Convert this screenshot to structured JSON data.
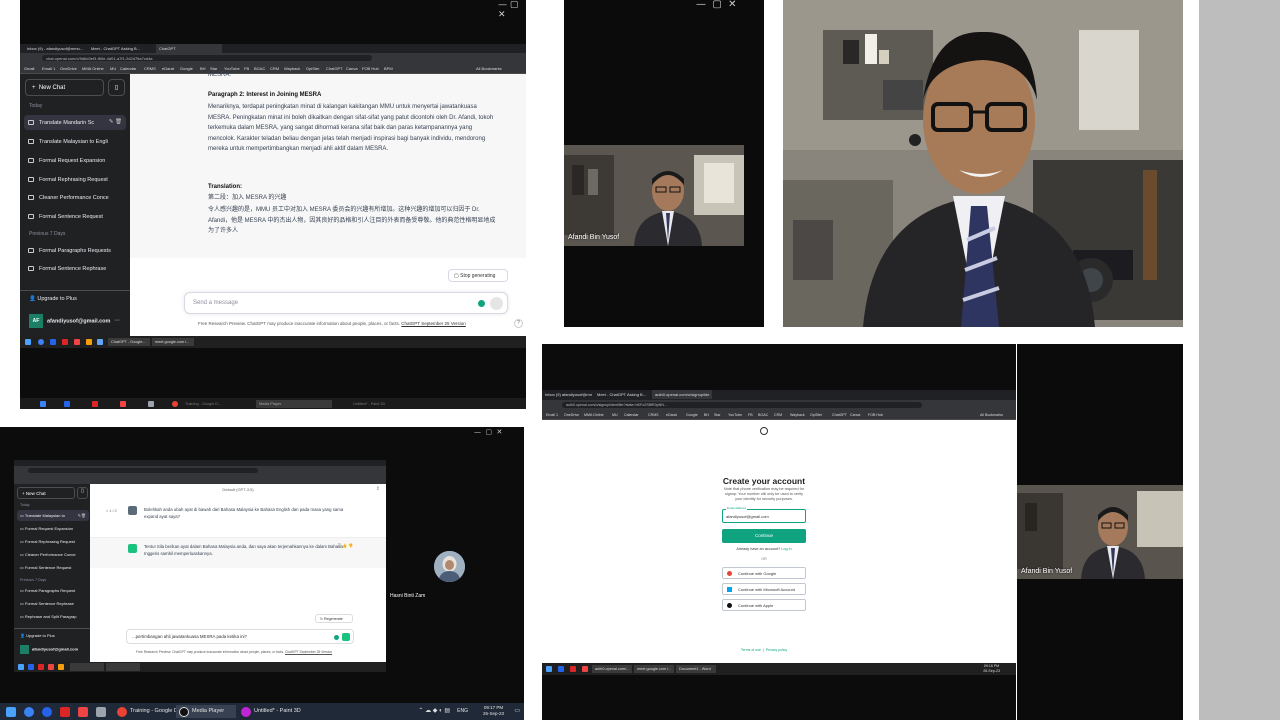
{
  "panel1": {
    "tabs": [
      "Inbox (9) - afandiyusof@mmu...",
      "Meet - ChatGPT Asking B...",
      "ChatGPT"
    ],
    "url": "chat.openai.com/c/9d6d3ef3-f60e-4d01-a7f1-2d2d76a7cd4a",
    "bookmarks": [
      "Gmail",
      "Email 1",
      "OneDrive",
      "MMA Online",
      "MU",
      "Calendar",
      "CRMS",
      "eDarat",
      "Google",
      "BH",
      "Star",
      "YouTube",
      "FB",
      "BGAC",
      "CRM",
      "Wayback",
      "OpiSter",
      "ChatGPT",
      "Canva",
      "FOB Hub",
      "BPM",
      "All Bookmarks"
    ],
    "new_chat": "New Chat",
    "section_today": "Today",
    "section_prev": "Previous 7 Days",
    "sidebar_today": [
      "Translate Mandarin Sc",
      "Translate Malaysian to Engli",
      "Formal Request Expansion",
      "Formal Rephrasing Request",
      "Cleaner Performance Conce",
      "Formal Sentence Request"
    ],
    "sidebar_prev": [
      "Formal Paragraphs Requests",
      "Formal Sentence Rephrase"
    ],
    "upgrade": "Upgrade to Plus",
    "user_initials": "AF",
    "user_email": "afandiyusof@gmail.com",
    "cut_line": "MESRA.",
    "para2_heading": "Paragraph 2: Interest in Joining MESRA",
    "para2_body": "Menariknya, terdapat peningkatan minat di kalangan kakitangan MMU untuk menyertai jawatankuasa MESRA. Peningkatan minat ini boleh dikaitkan dengan sifat-sifat yang patut dicontohi oleh Dr. Afandi, tokoh terkemuka dalam MESRA, yang sangat dihormati kerana sifat baik dan paras ketampanannya yang mencolok. Karakter teladan beliau dengan jelas telah menjadi inspirasi bagi banyak individu, mendorong mereka untuk mempertimbangkan menjadi ahli aktif dalam MESRA.",
    "translation_heading": "Translation:",
    "translation_sub": "第二段：加入 MESRA 的兴趣",
    "translation_body": "令人感兴趣的是，MMU 员工中对加入 MESRA 委员会的兴趣有所增加。这种兴趣的增加可以归因于 Dr. Afandi，他是 MESRA 中的杰出人物，因其良好的品格和引人注目的外表而备受尊敬。他的典范性格明显地成为了许多人",
    "stop_generating": "Stop generating",
    "send_placeholder": "Send a message",
    "footer": "Free Research Preview. ChatGPT may produce inaccurate information about people, places, or facts.",
    "footer_link": "ChatGPT September 25 Version",
    "taskbar_apps": [
      "ChatGPT - Google...",
      "meet.google.com i..."
    ]
  },
  "panel1_taskbar2": [
    "Training - Google D...",
    "Media Player",
    "Untitled* - Paint 3D"
  ],
  "video1": {
    "name": "Afandi Bin Yusof"
  },
  "video2": {
    "name": "Afandi Bin Yusof"
  },
  "panel3": {
    "tabs": [
      "Inbox (9) afandiyusof@mmu...",
      "Meet - ChatGPT Asking B...",
      "auth0.openai.com/u/signup/ide"
    ],
    "url": "auth0.openai.com/u/signup/identifier?state=hKFo2SBfR0pNN...",
    "title": "Create your account",
    "subtitle": "Note that phone verification may be required for signup. Your number will only be used to verify your identity for security purposes.",
    "email_label": "Email address",
    "email_value": "afandiyusof@gmail.com",
    "continue": "Continue",
    "login_prompt": "Already have an account?",
    "login_link": "Log in",
    "or": "OR",
    "continue_google": "Continue with Google",
    "continue_microsoft": "Continue with Microsoft Account",
    "continue_apple": "Continue with Apple",
    "terms": "Terms of use",
    "privacy": "Privacy policy",
    "taskbar_apps": [
      "auth0.openai.com/...",
      "meet.google.com i...",
      "Document1 - Word"
    ],
    "clock": "09:16 PM",
    "date": "26-Sep-23"
  },
  "panel4": {
    "model": "Default (GPT-3.5)",
    "new_chat": "New Chat",
    "section_today": "Today",
    "section_prev": "Previous 7 Days",
    "sidebar_today": [
      "Translate Malaysian to",
      "Formal Request Expansion",
      "Formal Rephrasing Request",
      "Cleaner Performance Conce",
      "Formal Sentence Request"
    ],
    "sidebar_prev": [
      "Formal Paragraphs Request",
      "Formal Sentence Rephrase",
      "Rephrase and Split Paragrap"
    ],
    "upgrade": "Upgrade to Plus",
    "user_email": "afandiyusof@gmail.com",
    "pager": "< 1 / 2",
    "user_msg": "Bolehkah anda ubah ayat di bawah dari Bahasa Malaysia ke Bahasa English dan pada masa yang sama expand ayat saya?",
    "asst_msg": "Tentu! Sila berikan ayat dalam Bahasa Malaysia anda, dan saya akan terjemahkannya ke dalam Bahasa Inggeris sambil memperluaskannya.",
    "regenerate": "Regenerate",
    "input_text": "...pertimbangan ahli jawatankuasa MESRA pada ketika ini?",
    "footer": "Free Research Preview. ChatGPT may produce inaccurate information about people, places, or facts.",
    "footer_link": "ChatGPT September 25 Version",
    "participant": "Hasni Binti Zam",
    "taskbar_apps": [
      "Training - Google D...",
      "Media Player",
      "Untitled* - Paint 3D"
    ],
    "lang": "ENG",
    "clock": "09:17 PM",
    "date": "26-Sep-23"
  },
  "colors": {
    "gpt_green": "#10a37f",
    "sidebar": "#202123",
    "taskbar": "#202020"
  }
}
